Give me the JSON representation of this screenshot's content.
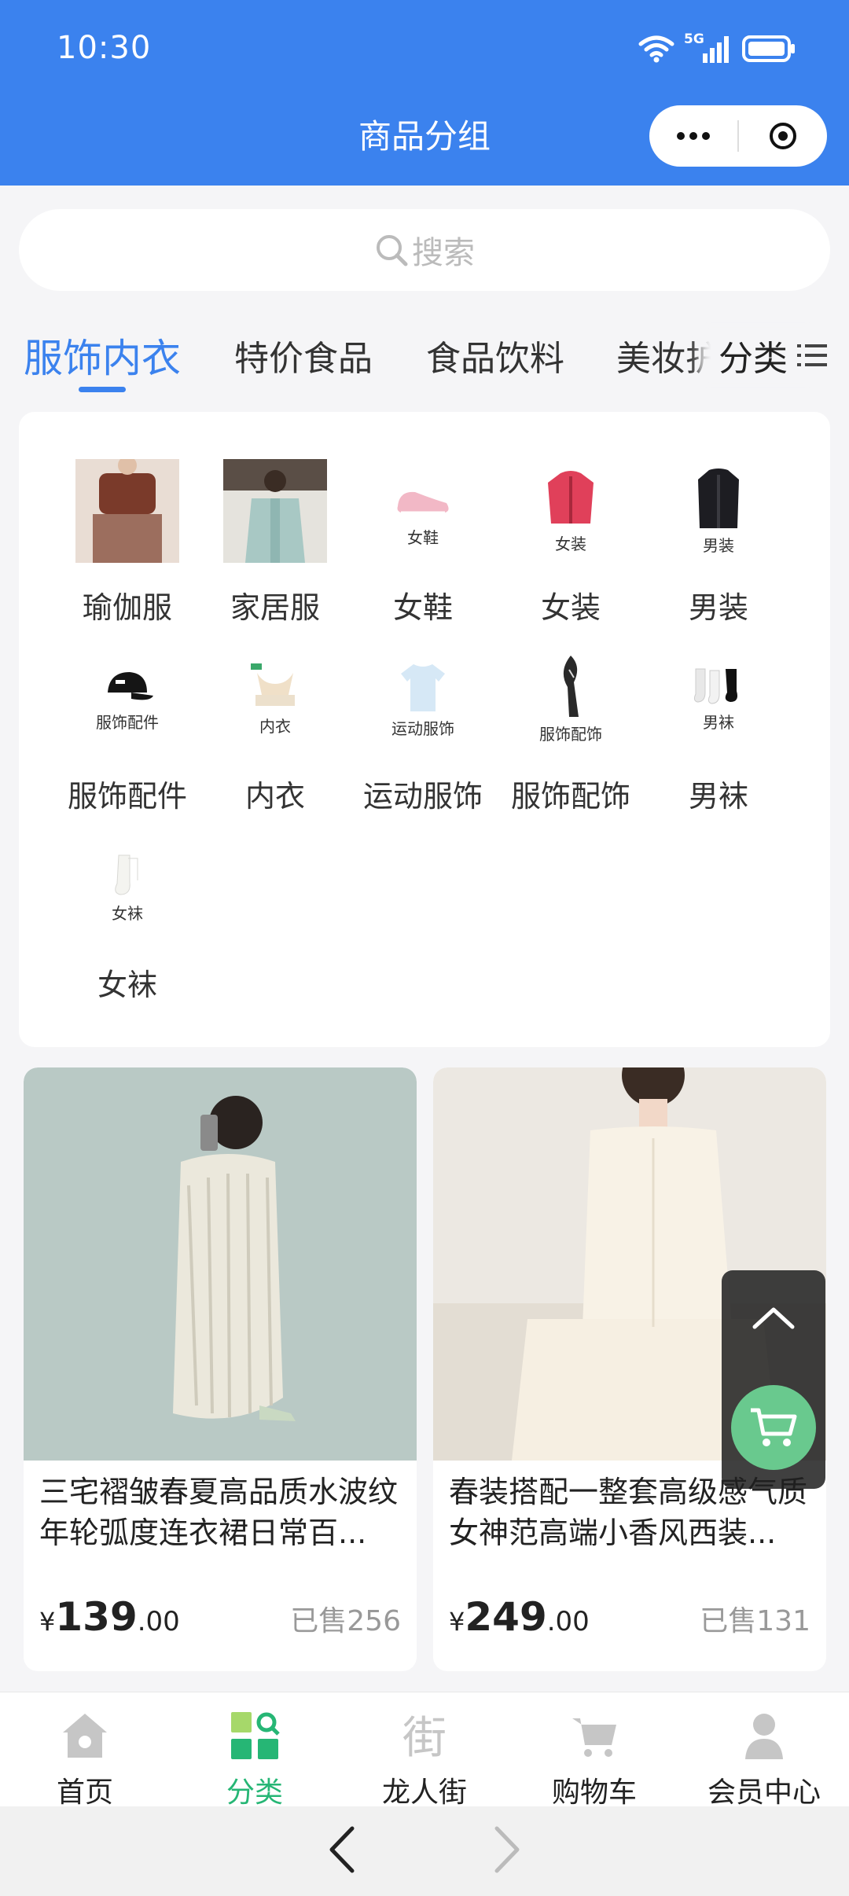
{
  "status": {
    "time": "10:30",
    "network": "5G"
  },
  "header": {
    "title": "商品分组"
  },
  "search": {
    "placeholder": "搜索"
  },
  "tabs": [
    {
      "label": "服饰内衣",
      "active": true
    },
    {
      "label": "特价食品",
      "active": false
    },
    {
      "label": "食品饮料",
      "active": false
    },
    {
      "label": "美妆护",
      "active": false
    }
  ],
  "category_button": {
    "label": "分类"
  },
  "categories": [
    {
      "label": "瑜伽服",
      "mini": "",
      "icon": "yoga-wear-photo"
    },
    {
      "label": "家居服",
      "mini": "",
      "icon": "home-wear-photo"
    },
    {
      "label": "女鞋",
      "mini": "女鞋",
      "icon": "women-shoes-icon"
    },
    {
      "label": "女装",
      "mini": "女装",
      "icon": "women-jacket-icon"
    },
    {
      "label": "男装",
      "mini": "男装",
      "icon": "men-coat-icon"
    },
    {
      "label": "服饰配件",
      "mini": "服饰配件",
      "icon": "cap-icon"
    },
    {
      "label": "内衣",
      "mini": "内衣",
      "icon": "bra-icon"
    },
    {
      "label": "运动服饰",
      "mini": "运动服饰",
      "icon": "tshirt-icon"
    },
    {
      "label": "服饰配饰",
      "mini": "服饰配饰",
      "icon": "scarf-icon"
    },
    {
      "label": "男袜",
      "mini": "男袜",
      "icon": "men-socks-icon"
    },
    {
      "label": "女袜",
      "mini": "女袜",
      "icon": "women-socks-icon"
    }
  ],
  "products": [
    {
      "name": "三宅褶皱春夏高品质水波纹年轮弧度连衣裙日常百...",
      "currency": "¥",
      "price_int": "139",
      "price_dec": ".00",
      "sold": "已售256"
    },
    {
      "name": "春装搭配一整套高级感气质女神范高端小香风西装...",
      "currency": "¥",
      "price_int": "249",
      "price_dec": ".00",
      "sold": "已售131"
    }
  ],
  "bottom_nav": [
    {
      "label": "首页",
      "active": false
    },
    {
      "label": "分类",
      "active": true
    },
    {
      "label": "龙人街",
      "active": false
    },
    {
      "label": "购物车",
      "active": false
    },
    {
      "label": "会员中心",
      "active": false
    }
  ],
  "colors": {
    "primary": "#3b82ee",
    "active_nav": "#26b675",
    "cart_float": "#69c98e"
  }
}
